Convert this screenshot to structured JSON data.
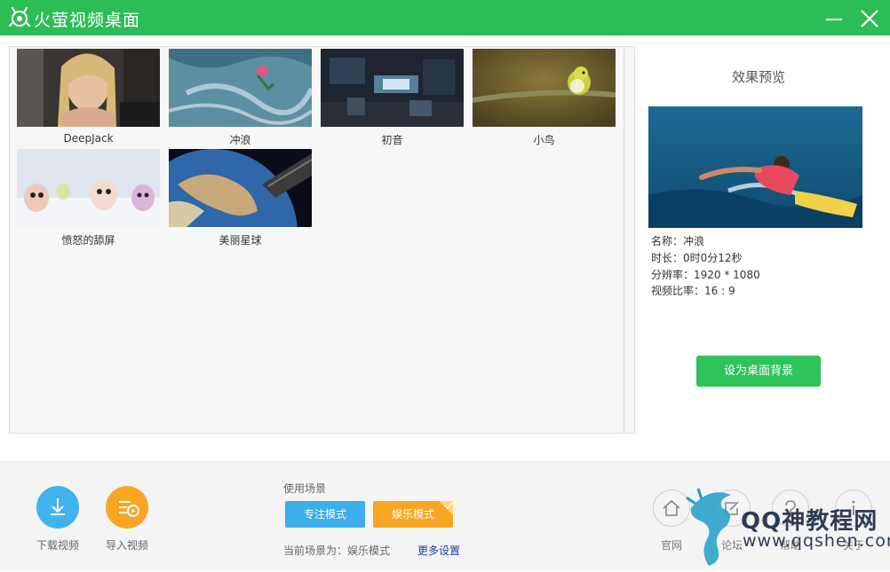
{
  "app": {
    "title": "火萤视频桌面"
  },
  "videos": [
    {
      "label": "DeepJack"
    },
    {
      "label": "冲浪"
    },
    {
      "label": "初音"
    },
    {
      "label": "小鸟"
    },
    {
      "label": "愤怒的舔屏"
    },
    {
      "label": "美丽星球"
    }
  ],
  "preview": {
    "title": "效果预览",
    "name_line": "名称：冲浪",
    "duration_line": "时长：0时0分12秒",
    "resolution_line": "分辨率：1920 * 1080",
    "ratio_line": "视频比率：16 : 9",
    "set_button": "设为桌面背景"
  },
  "bottom": {
    "download_label": "下载视频",
    "import_label": "导入视频",
    "scene_label": "使用场景",
    "focus_mode": "专注模式",
    "fun_mode": "娱乐模式",
    "current_scene": "当前场景为：娱乐模式",
    "more_settings": "更多设置",
    "links": [
      {
        "label": "官网",
        "icon": "home-icon"
      },
      {
        "label": "论坛",
        "icon": "edit-icon"
      },
      {
        "label": "帮助",
        "icon": "help-icon"
      },
      {
        "label": "关于",
        "icon": "info-icon"
      }
    ]
  },
  "watermark": {
    "text_cn": "QQ神教程网",
    "text_url": "www.qqshen.com"
  },
  "colors": {
    "brand": "#2dbd57",
    "blue": "#3daee9",
    "orange": "#f7a624",
    "link": "#1a3fb0"
  }
}
